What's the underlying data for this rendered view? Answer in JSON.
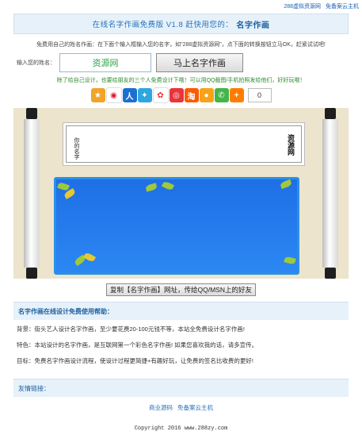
{
  "top_links": [
    "288虚拟资源网",
    "免备案云主机"
  ],
  "header": {
    "title": "在线名字作画免费版 V1.8 赶快用您的：",
    "title_bold": "名字作画"
  },
  "hint": "免费用自己的姓名作画：在下面个输入框输入您的名字，如\"288虚拟资源网\"，点下面的转换按钮立马OK，赶紧试试吧!",
  "form": {
    "label": "输入您的姓名：",
    "value": "资源网",
    "button": "马上名字作画"
  },
  "green_line": "除了给自己设计，也要给朋友的三个人免费设计下哦！可以用QQ截图/手机拍照发给他们，好好玩哦！",
  "share": {
    "count": "0",
    "icons": [
      "star-icon",
      "weibo-icon",
      "renren-icon",
      "qzone-icon",
      "baidu-icon",
      "sohu-icon",
      "taobao-icon",
      "orange-icon",
      "wechat-icon",
      "more-icon"
    ]
  },
  "scroll": {
    "left_text": "你的名字",
    "right_text": "资源网"
  },
  "copy_button": "复制【名字作画】网址，传给QQ/MSN上的好友",
  "intro": {
    "head": "名字作画在线设计免费使用帮助：",
    "lines": [
      "背景：街头艺人设计名字作画，至少要花费20-100元钱不等，本站全免费设计名字作画!",
      "特色：本站设计的名字作画，是互联网第一个彩色名字作画! 如果您喜欢我的话，请多宣传。",
      "目标：免费名字作画设计流程，使设计过程更简捷+有趣好玩，让免费的签名比收费的更好!"
    ]
  },
  "links": {
    "head": "友情链接：",
    "items": [
      "商业源码",
      "免备案云主机"
    ]
  },
  "footer": "Copyright 2016 www.288zy.com"
}
